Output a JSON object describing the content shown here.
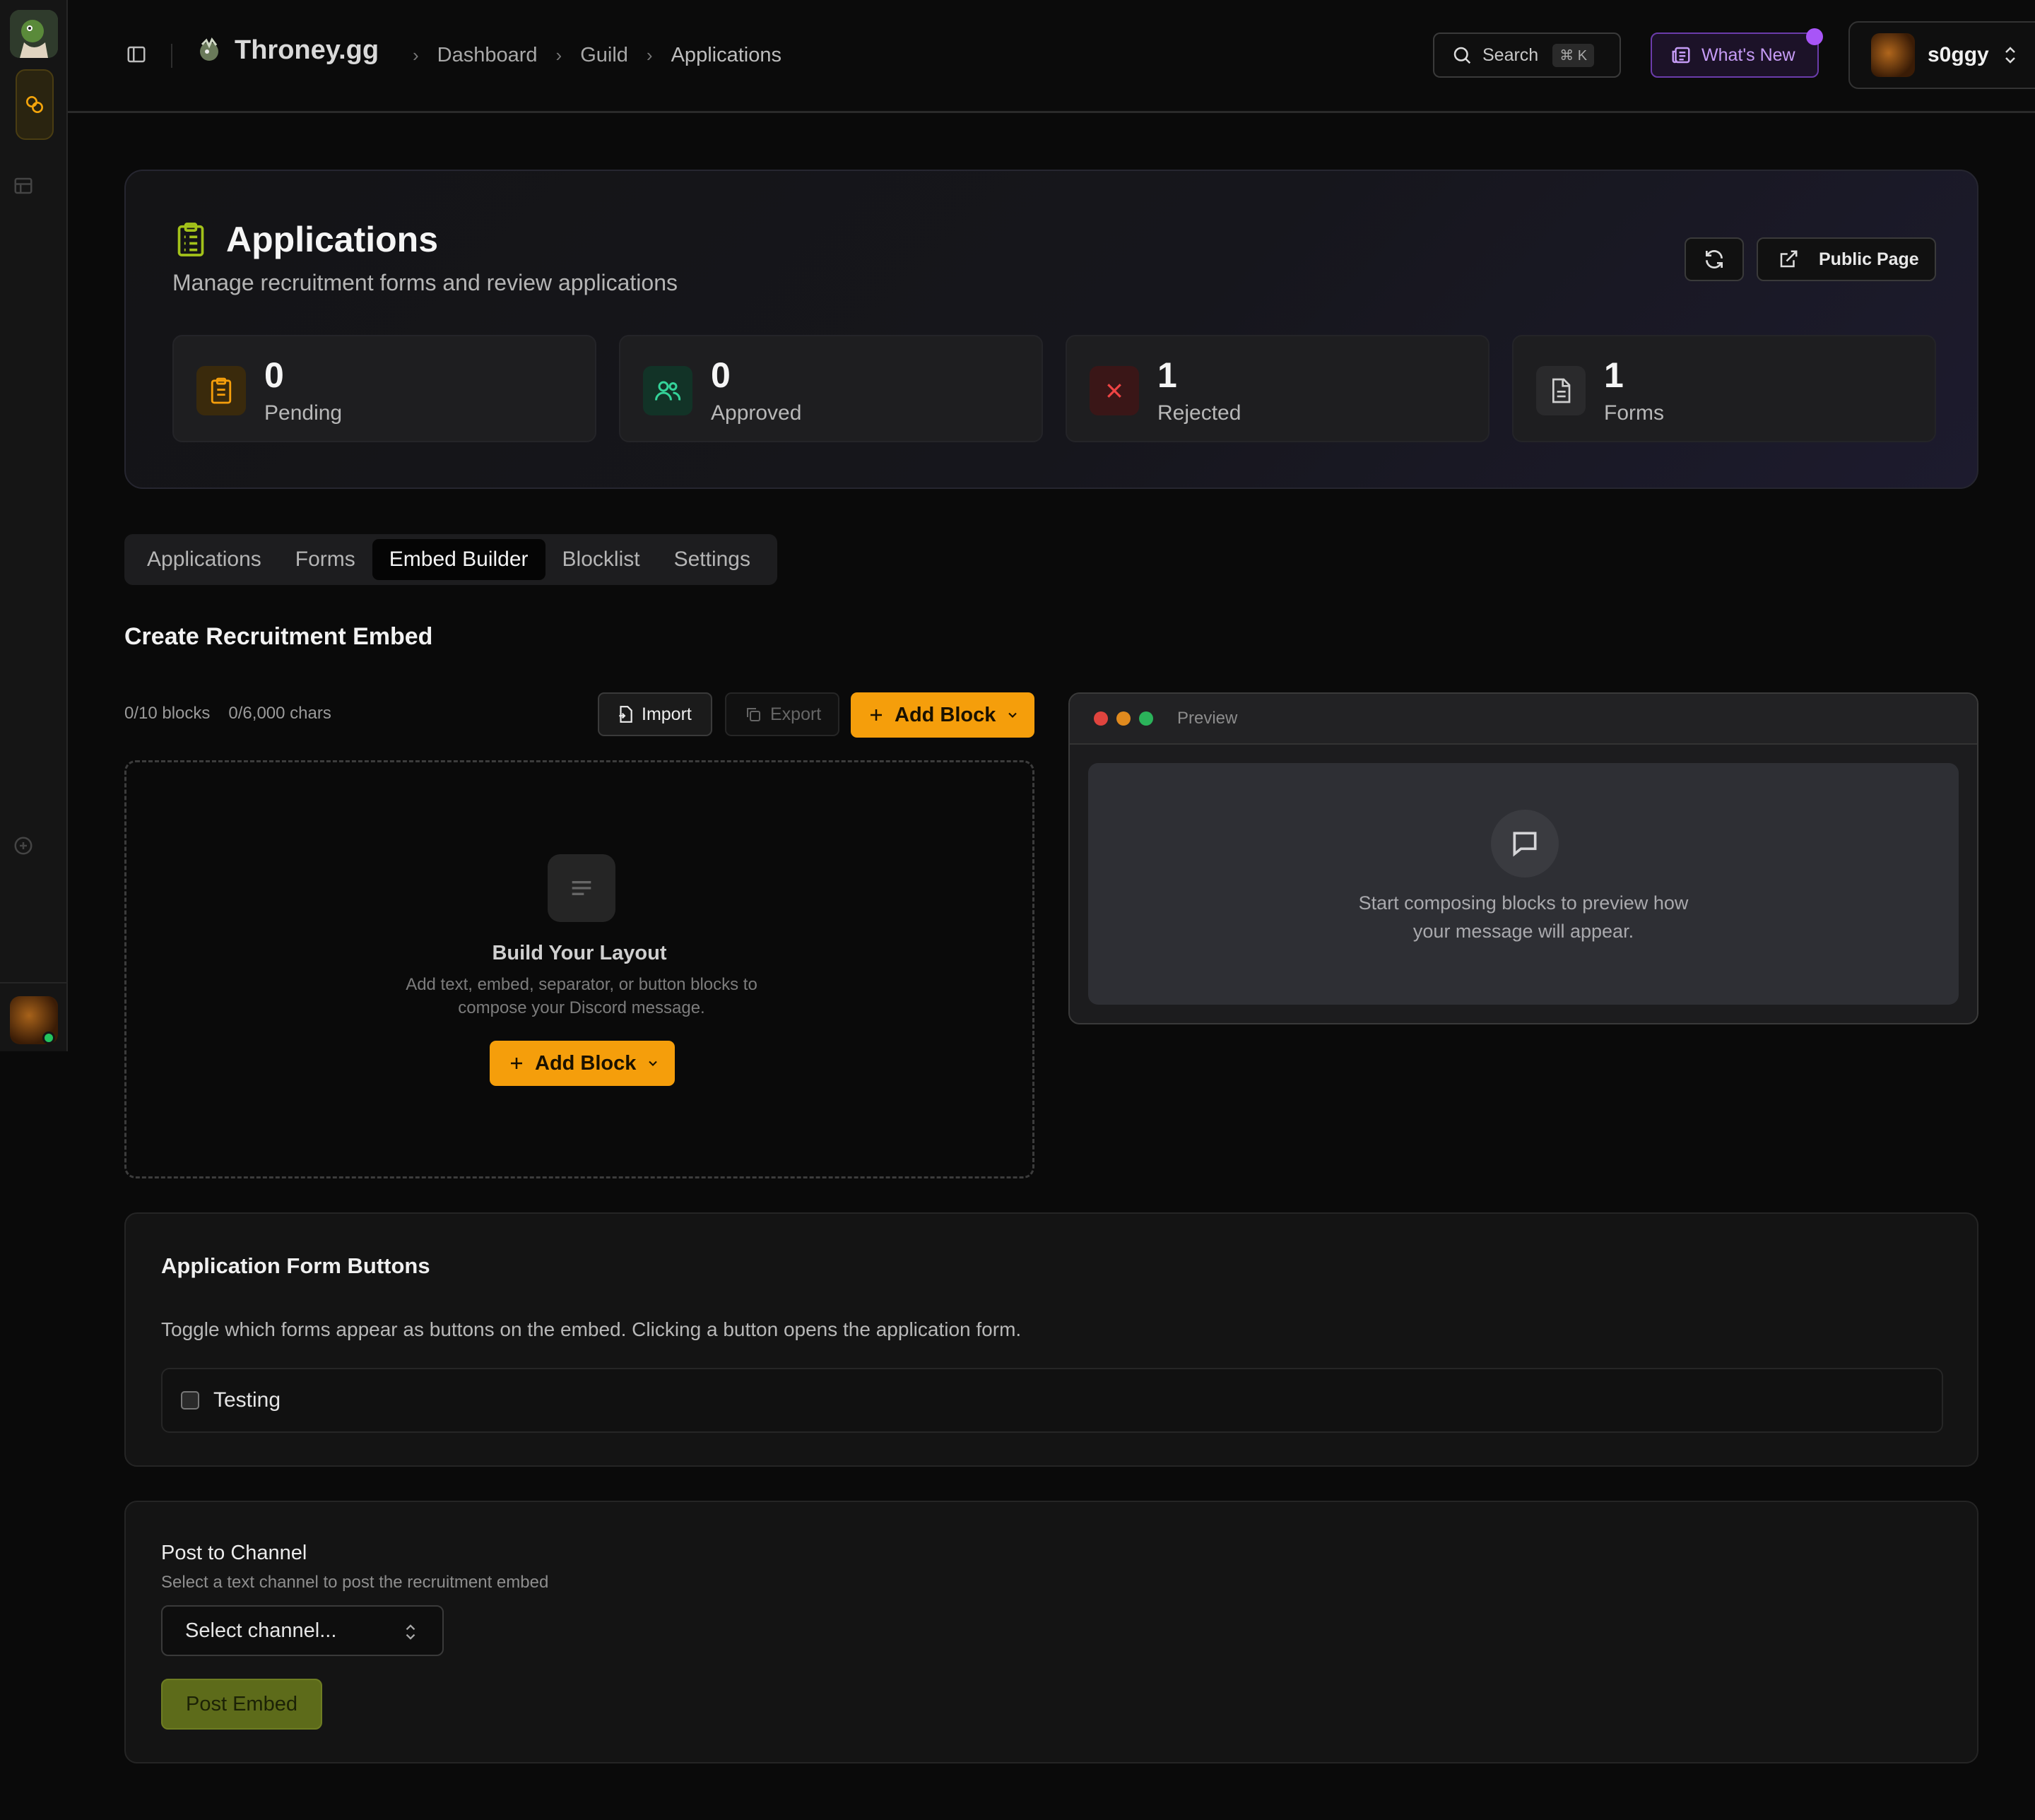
{
  "brand": {
    "name": "Throney.gg"
  },
  "breadcrumb": {
    "items": [
      "Dashboard",
      "Guild",
      "Applications"
    ]
  },
  "topbar": {
    "search_label": "Search",
    "search_shortcut": "⌘ K",
    "whats_new_label": "What's New",
    "user_name": "s0ggy"
  },
  "hero": {
    "title": "Applications",
    "subtitle": "Manage recruitment forms and review applications",
    "public_page_label": "Public Page"
  },
  "stats": [
    {
      "value": "0",
      "label": "Pending",
      "color": "#f59e0b"
    },
    {
      "value": "0",
      "label": "Approved",
      "color": "#34d399"
    },
    {
      "value": "1",
      "label": "Rejected",
      "color": "#ef4444"
    },
    {
      "value": "1",
      "label": "Forms",
      "color": "#b5b5b5"
    }
  ],
  "tabs": [
    "Applications",
    "Forms",
    "Embed Builder",
    "Blocklist",
    "Settings"
  ],
  "active_tab": "Embed Builder",
  "builder": {
    "title": "Create Recruitment Embed",
    "blocks_count": "0/10 blocks",
    "chars_count": "0/6,000 chars",
    "import_label": "Import",
    "export_label": "Export",
    "add_block_label": "Add Block",
    "empty_title": "Build Your Layout",
    "empty_desc": "Add text, embed, separator, or button blocks to compose your Discord message."
  },
  "preview": {
    "label": "Preview",
    "empty_text": "Start composing blocks to preview how your message will appear."
  },
  "form_buttons": {
    "title": "Application Form Buttons",
    "desc": "Toggle which forms appear as buttons on the embed. Clicking a button opens the application form.",
    "items": [
      {
        "label": "Testing",
        "checked": false
      }
    ]
  },
  "post": {
    "title": "Post to Channel",
    "subtitle": "Select a text channel to post the recruitment embed",
    "select_placeholder": "Select channel...",
    "post_label": "Post Embed"
  },
  "colors": {
    "accent": "#f59e0b",
    "brand_purple": "#a855f7",
    "post_green": "#5d6b1a"
  }
}
